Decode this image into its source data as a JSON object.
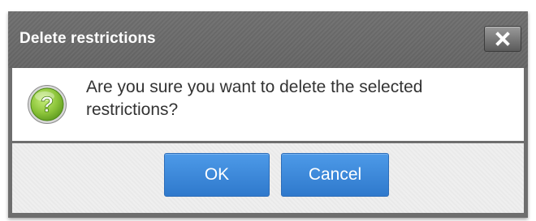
{
  "dialog": {
    "title": "Delete restrictions",
    "close_icon": "close-icon",
    "question_icon": "question-icon",
    "message": "Are you sure you want to delete the selected restrictions?",
    "ok_label": "OK",
    "cancel_label": "Cancel"
  },
  "colors": {
    "titlebar": "#6e6e6e",
    "button_blue": "#3d8ade",
    "icon_green": "#8cc43a",
    "footer_bg": "#efefef"
  }
}
